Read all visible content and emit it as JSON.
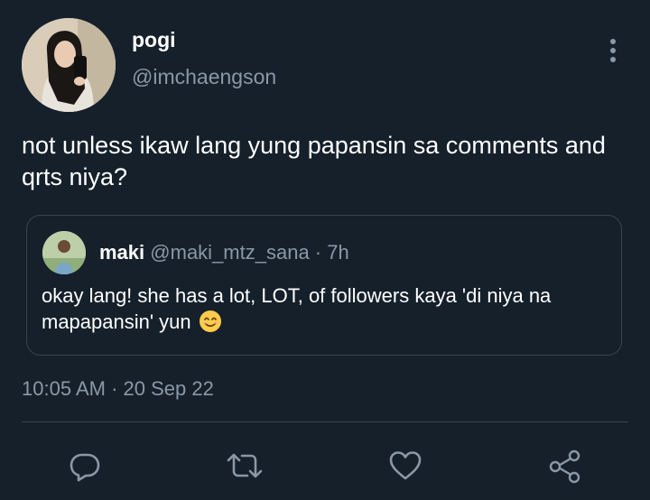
{
  "tweet": {
    "display_name": "pogi",
    "handle": "@imchaengson",
    "text": "not unless ikaw lang yung papansin sa comments and qrts niya?",
    "timestamp": "10:05 AM · 20 Sep 22"
  },
  "quoted_tweet": {
    "display_name": "maki",
    "handle": "@maki_mtz_sana",
    "separator": " · ",
    "age": "7h",
    "text": "okay lang! she has a lot, LOT, of followers kaya 'di niya na mapapansin' yun",
    "emoji": "smiling-face-emoji"
  },
  "actions": {
    "reply_icon": "reply-icon",
    "retweet_icon": "retweet-icon",
    "like_icon": "heart-icon",
    "share_icon": "share-icon"
  },
  "colors": {
    "background": "#15202b",
    "primary_text": "#ffffff",
    "secondary_text": "#8b98a5",
    "border": "#38444d"
  }
}
